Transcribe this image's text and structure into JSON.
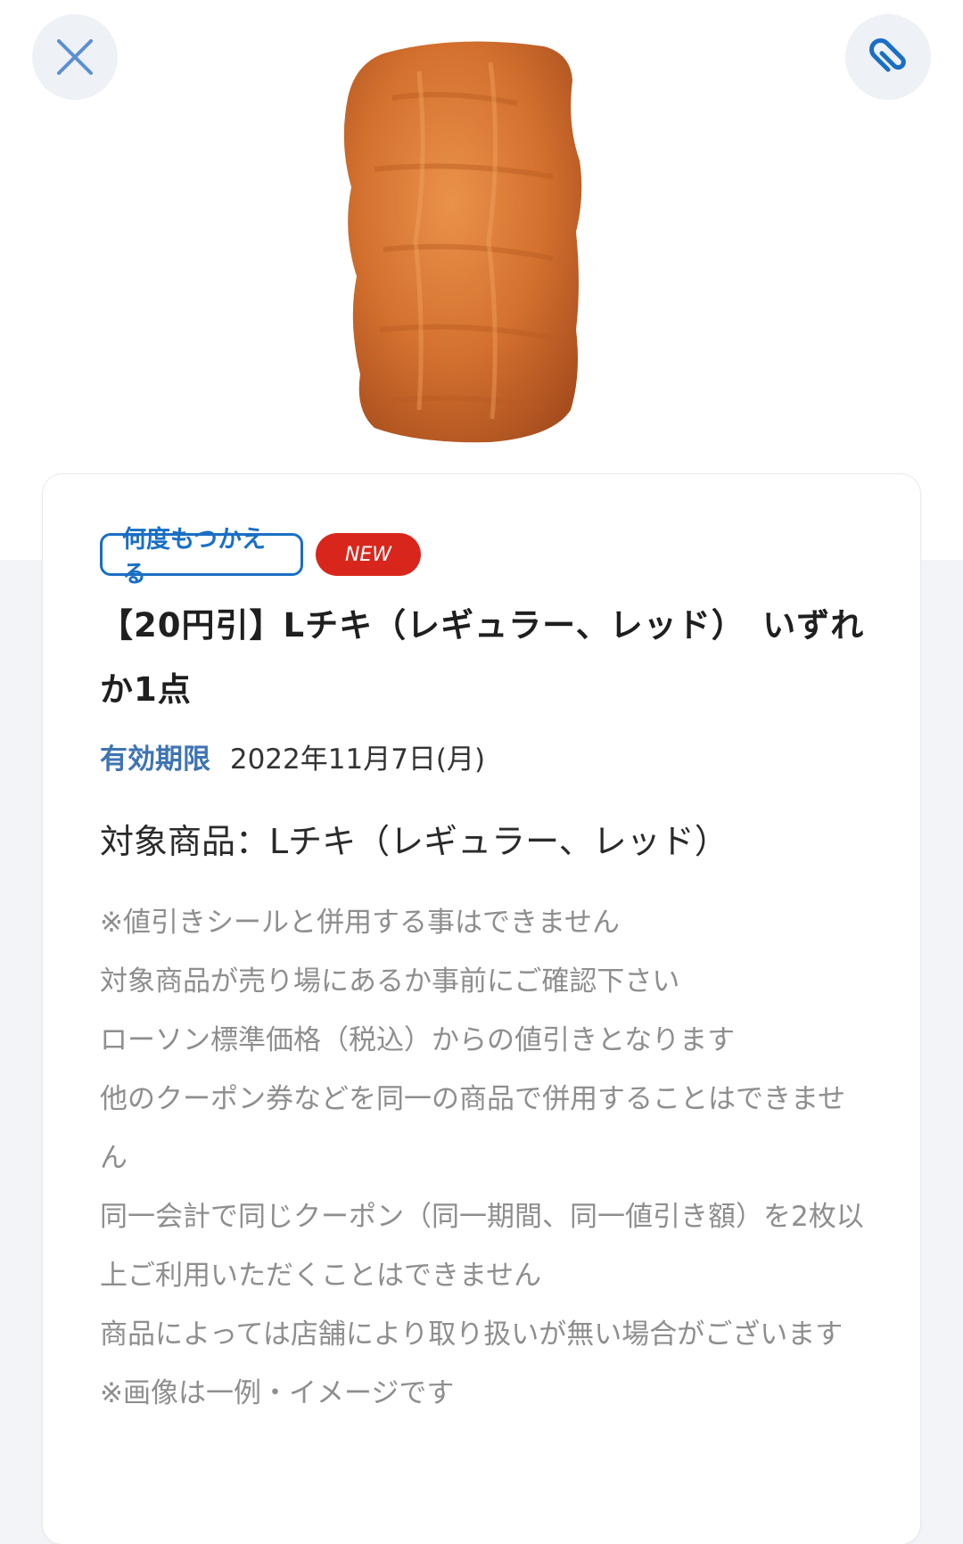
{
  "header": {
    "close_icon": "close-icon",
    "clip_icon": "paperclip-icon",
    "accent_color": "#1a6fc4"
  },
  "product": {
    "image_alt": "Lチキ"
  },
  "coupon": {
    "badges": {
      "reusable": "何度もつかえる",
      "new": "NEW"
    },
    "title": "【20円引】Lチキ（レギュラー、レッド）　いずれか1点",
    "expiry": {
      "label": "有効期限",
      "value": "2022年11月7日(月)"
    },
    "target_product": "対象商品：Lチキ（レギュラー、レッド）",
    "notes": [
      "※値引きシールと併用する事はできません",
      "対象商品が売り場にあるか事前にご確認下さい",
      "ローソン標準価格（税込）からの値引きとなります",
      "他のクーポン券などを同一の商品で併用することはできません",
      "同一会計で同じクーポン（同一期間、同一値引き額）を2枚以上ご利用いただくことはできません",
      "商品によっては店舗により取り扱いが無い場合がございます",
      "※画像は一例・イメージです"
    ]
  }
}
